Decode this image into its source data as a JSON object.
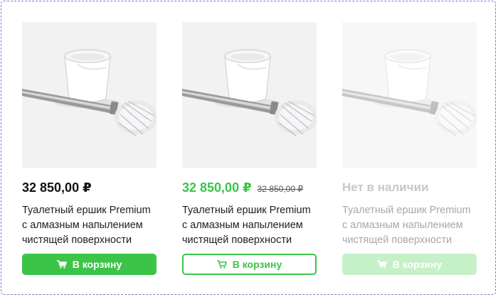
{
  "products": [
    {
      "price": "32 850,00 ₽",
      "old_price": "",
      "title": "Туалетный ершик Premium с алмазным напылением чистящей поверхности",
      "button_label": "В корзину",
      "status": "available"
    },
    {
      "price": "32 850,00 ₽",
      "old_price": "32 850,00 ₽",
      "title": "Туалетный ершик Premium с алмазным напылением чистящей поверхности",
      "button_label": "В корзину",
      "status": "sale"
    },
    {
      "availability": "Нет в наличии",
      "title": "Туалетный ершик Premium с алмазным напылением чистящей поверхности",
      "button_label": "В корзину",
      "status": "out_of_stock"
    }
  ],
  "icons": {
    "cart": "cart-icon"
  },
  "colors": {
    "accent": "#3cc449",
    "accent_disabled": "#c5f0c8",
    "border": "#9b6bd6"
  }
}
